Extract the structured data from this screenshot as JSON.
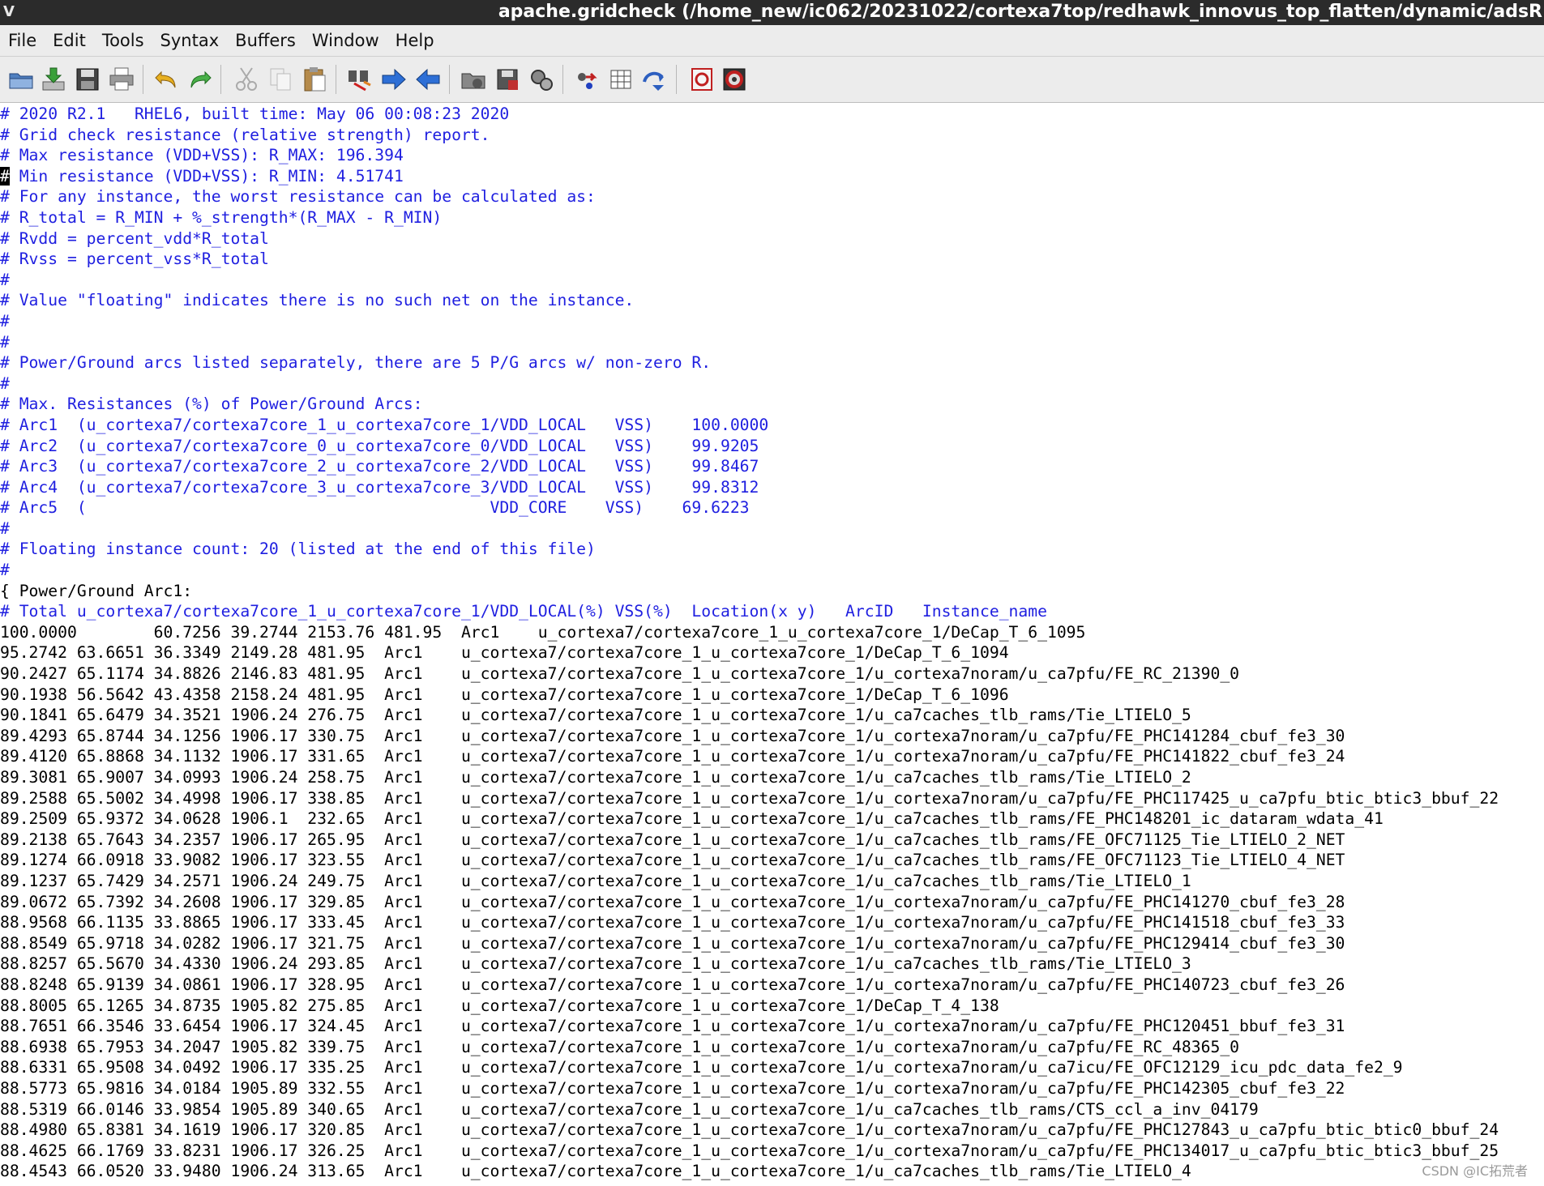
{
  "window": {
    "title": "apache.gridcheck (/home_new/ic062/20231022/cortexa7top/redhawk_innovus_top_flatten/dynamic/adsR",
    "app_icon": "V"
  },
  "menu": [
    "File",
    "Edit",
    "Tools",
    "Syntax",
    "Buffers",
    "Window",
    "Help"
  ],
  "toolbar": {
    "icons": [
      "open-icon",
      "save-download-icon",
      "save-icon",
      "print-icon",
      "undo-icon",
      "redo-icon",
      "cut-icon",
      "copy-icon",
      "paste-icon",
      "find-replace-icon",
      "forward-icon",
      "back-icon",
      "load-session-icon",
      "save-session-icon",
      "run-script-icon",
      "make-icon",
      "build-tags-icon",
      "jump-tag-icon",
      "help-icon",
      "find-help-icon"
    ]
  },
  "editor": {
    "header_lines": [
      "# 2020 R2.1   RHEL6, built time: May 06 00:08:23 2020",
      "# Grid check resistance (relative strength) report.",
      "# Max resistance (VDD+VSS): R_MAX: 196.394",
      "# Min resistance (VDD+VSS): R_MIN: 4.51741",
      "# For any instance, the worst resistance can be calculated as:",
      "# R_total = R_MIN + %_strength*(R_MAX - R_MIN)",
      "# Rvdd = percent_vdd*R_total",
      "# Rvss = percent_vss*R_total",
      "#",
      "# Value \"floating\" indicates there is no such net on the instance.",
      "#",
      "#",
      "# Power/Ground arcs listed separately, there are 5 P/G arcs w/ non-zero R.",
      "#",
      "# Max. Resistances (%) of Power/Ground Arcs:",
      "# Arc1  (u_cortexa7/cortexa7core_1_u_cortexa7core_1/VDD_LOCAL   VSS)    100.0000",
      "# Arc2  (u_cortexa7/cortexa7core_0_u_cortexa7core_0/VDD_LOCAL   VSS)    99.9205",
      "# Arc3  (u_cortexa7/cortexa7core_2_u_cortexa7core_2/VDD_LOCAL   VSS)    99.8467",
      "# Arc4  (u_cortexa7/cortexa7core_3_u_cortexa7core_3/VDD_LOCAL   VSS)    99.8312",
      "# Arc5  (                                          VDD_CORE    VSS)    69.6223",
      "#",
      "# Floating instance count: 20 (listed at the end of this file)",
      "#"
    ],
    "block_open": "{ Power/Ground Arc1:",
    "column_header": "# Total u_cortexa7/cortexa7core_1_u_cortexa7core_1/VDD_LOCAL(%) VSS(%)  Location(x y)   ArcID   Instance_name",
    "first_row": "100.0000        60.7256 39.2744 2153.76 481.95  Arc1    u_cortexa7/cortexa7core_1_u_cortexa7core_1/DeCap_T_6_1095",
    "rows": [
      "95.2742 63.6651 36.3349 2149.28 481.95  Arc1    u_cortexa7/cortexa7core_1_u_cortexa7core_1/DeCap_T_6_1094",
      "90.2427 65.1174 34.8826 2146.83 481.95  Arc1    u_cortexa7/cortexa7core_1_u_cortexa7core_1/u_cortexa7noram/u_ca7pfu/FE_RC_21390_0",
      "90.1938 56.5642 43.4358 2158.24 481.95  Arc1    u_cortexa7/cortexa7core_1_u_cortexa7core_1/DeCap_T_6_1096",
      "90.1841 65.6479 34.3521 1906.24 276.75  Arc1    u_cortexa7/cortexa7core_1_u_cortexa7core_1/u_ca7caches_tlb_rams/Tie_LTIELO_5",
      "89.4293 65.8744 34.1256 1906.17 330.75  Arc1    u_cortexa7/cortexa7core_1_u_cortexa7core_1/u_cortexa7noram/u_ca7pfu/FE_PHC141284_cbuf_fe3_30",
      "89.4120 65.8868 34.1132 1906.17 331.65  Arc1    u_cortexa7/cortexa7core_1_u_cortexa7core_1/u_cortexa7noram/u_ca7pfu/FE_PHC141822_cbuf_fe3_24",
      "89.3081 65.9007 34.0993 1906.24 258.75  Arc1    u_cortexa7/cortexa7core_1_u_cortexa7core_1/u_ca7caches_tlb_rams/Tie_LTIELO_2",
      "89.2588 65.5002 34.4998 1906.17 338.85  Arc1    u_cortexa7/cortexa7core_1_u_cortexa7core_1/u_cortexa7noram/u_ca7pfu/FE_PHC117425_u_ca7pfu_btic_btic3_bbuf_22",
      "89.2509 65.9372 34.0628 1906.1  232.65  Arc1    u_cortexa7/cortexa7core_1_u_cortexa7core_1/u_ca7caches_tlb_rams/FE_PHC148201_ic_dataram_wdata_41",
      "89.2138 65.7643 34.2357 1906.17 265.95  Arc1    u_cortexa7/cortexa7core_1_u_cortexa7core_1/u_ca7caches_tlb_rams/FE_OFC71125_Tie_LTIELO_2_NET",
      "89.1274 66.0918 33.9082 1906.17 323.55  Arc1    u_cortexa7/cortexa7core_1_u_cortexa7core_1/u_ca7caches_tlb_rams/FE_OFC71123_Tie_LTIELO_4_NET",
      "89.1237 65.7429 34.2571 1906.24 249.75  Arc1    u_cortexa7/cortexa7core_1_u_cortexa7core_1/u_ca7caches_tlb_rams/Tie_LTIELO_1",
      "89.0672 65.7392 34.2608 1906.17 329.85  Arc1    u_cortexa7/cortexa7core_1_u_cortexa7core_1/u_cortexa7noram/u_ca7pfu/FE_PHC141270_cbuf_fe3_28",
      "88.9568 66.1135 33.8865 1906.17 333.45  Arc1    u_cortexa7/cortexa7core_1_u_cortexa7core_1/u_cortexa7noram/u_ca7pfu/FE_PHC141518_cbuf_fe3_33",
      "88.8549 65.9718 34.0282 1906.17 321.75  Arc1    u_cortexa7/cortexa7core_1_u_cortexa7core_1/u_cortexa7noram/u_ca7pfu/FE_PHC129414_cbuf_fe3_30",
      "88.8257 65.5670 34.4330 1906.24 293.85  Arc1    u_cortexa7/cortexa7core_1_u_cortexa7core_1/u_ca7caches_tlb_rams/Tie_LTIELO_3",
      "88.8248 65.9139 34.0861 1906.17 328.95  Arc1    u_cortexa7/cortexa7core_1_u_cortexa7core_1/u_cortexa7noram/u_ca7pfu/FE_PHC140723_cbuf_fe3_26",
      "88.8005 65.1265 34.8735 1905.82 275.85  Arc1    u_cortexa7/cortexa7core_1_u_cortexa7core_1/DeCap_T_4_138",
      "88.7651 66.3546 33.6454 1906.17 324.45  Arc1    u_cortexa7/cortexa7core_1_u_cortexa7core_1/u_cortexa7noram/u_ca7pfu/FE_PHC120451_bbuf_fe3_31",
      "88.6938 65.7953 34.2047 1905.82 339.75  Arc1    u_cortexa7/cortexa7core_1_u_cortexa7core_1/u_cortexa7noram/u_ca7pfu/FE_RC_48365_0",
      "88.6331 65.9508 34.0492 1906.17 335.25  Arc1    u_cortexa7/cortexa7core_1_u_cortexa7core_1/u_cortexa7noram/u_ca7icu/FE_OFC12129_icu_pdc_data_fe2_9",
      "88.5773 65.9816 34.0184 1905.89 332.55  Arc1    u_cortexa7/cortexa7core_1_u_cortexa7core_1/u_cortexa7noram/u_ca7pfu/FE_PHC142305_cbuf_fe3_22",
      "88.5319 66.0146 33.9854 1905.89 340.65  Arc1    u_cortexa7/cortexa7core_1_u_cortexa7core_1/u_ca7caches_tlb_rams/CTS_ccl_a_inv_04179",
      "88.4980 65.8381 34.1619 1906.17 320.85  Arc1    u_cortexa7/cortexa7core_1_u_cortexa7core_1/u_cortexa7noram/u_ca7pfu/FE_PHC127843_u_ca7pfu_btic_btic0_bbuf_24",
      "88.4625 66.1769 33.8231 1906.17 326.25  Arc1    u_cortexa7/cortexa7core_1_u_cortexa7core_1/u_cortexa7noram/u_ca7pfu/FE_PHC134017_u_ca7pfu_btic_btic3_bbuf_25",
      "88.4543 66.0520 33.9480 1906.24 313.65  Arc1    u_cortexa7/cortexa7core_1_u_cortexa7core_1/u_ca7caches_tlb_rams/Tie_LTIELO_4"
    ]
  },
  "watermark": "CSDN @IC拓荒者",
  "colors": {
    "comment": "#1f1fe0",
    "text": "#000000",
    "titlebar": "#2b2b2b",
    "chrome": "#ececec"
  }
}
